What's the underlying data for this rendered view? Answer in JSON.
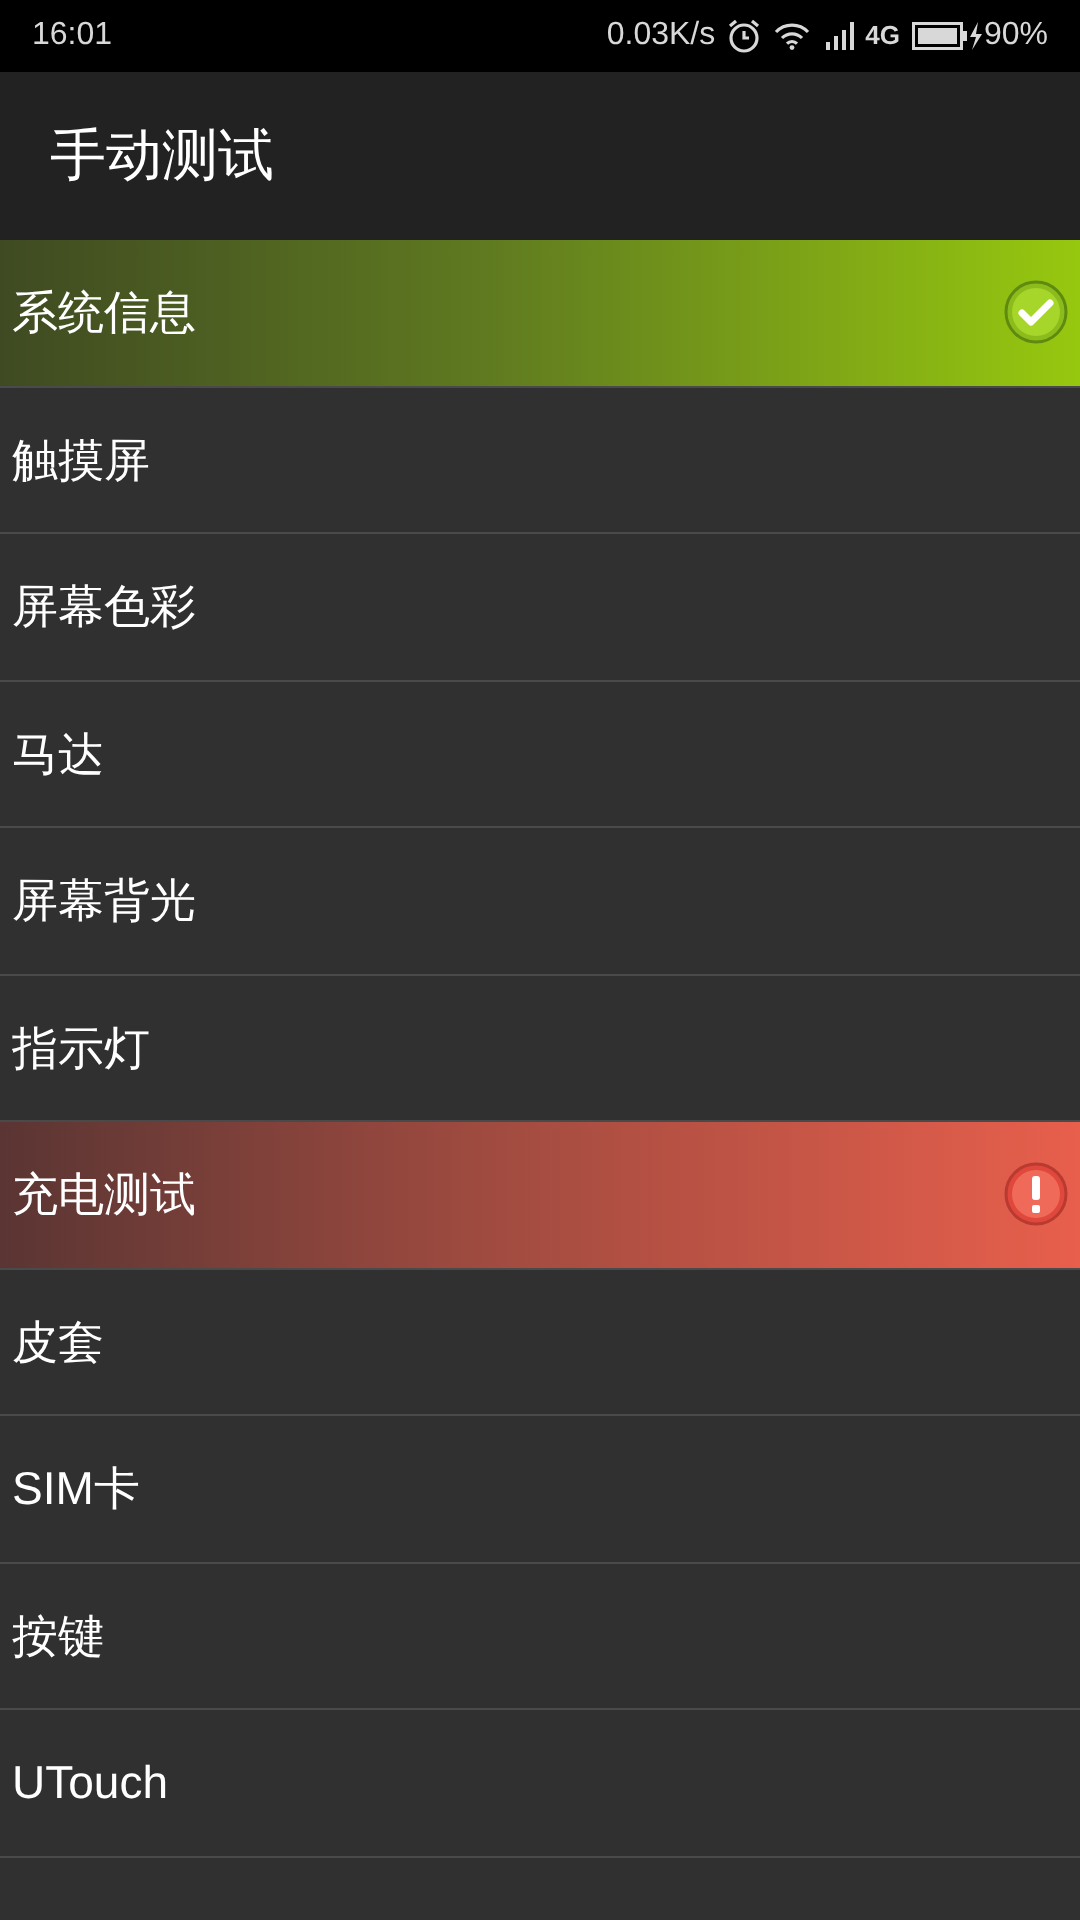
{
  "status_bar": {
    "time": "16:01",
    "speed": "0.03K/s",
    "network": "4G",
    "battery": "90%"
  },
  "header": {
    "title": "手动测试"
  },
  "items": [
    {
      "label": "系统信息",
      "kind": "pass"
    },
    {
      "label": "触摸屏",
      "kind": "none"
    },
    {
      "label": "屏幕色彩",
      "kind": "none"
    },
    {
      "label": "马达",
      "kind": "none"
    },
    {
      "label": "屏幕背光",
      "kind": "none"
    },
    {
      "label": "指示灯",
      "kind": "none"
    },
    {
      "label": "充电测试",
      "kind": "fail"
    },
    {
      "label": "皮套",
      "kind": "none"
    },
    {
      "label": "SIM卡",
      "kind": "none"
    },
    {
      "label": "按键",
      "kind": "none"
    },
    {
      "label": "UTouch",
      "kind": "none"
    }
  ]
}
